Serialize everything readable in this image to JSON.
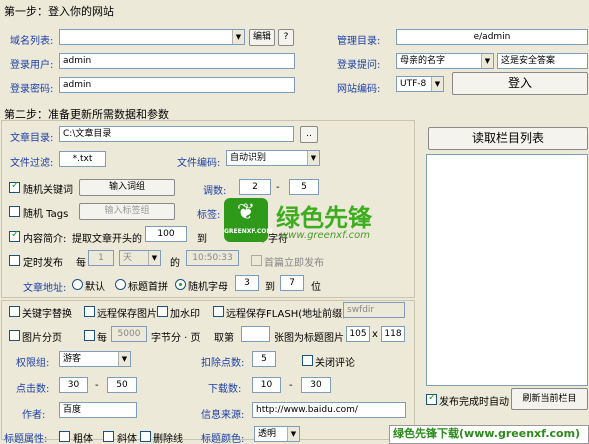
{
  "step1": {
    "title": "第一步：登入你的网站",
    "domain_label": "域名列表:",
    "domain_value": "",
    "edit_button": "编辑",
    "help_button": "?",
    "user_label": "登录用户:",
    "user_value": "admin",
    "password_label": "登录密码:",
    "password_value": "admin",
    "admin_dir_label": "管理目录:",
    "admin_dir_value": "e/admin",
    "prompt_label": "登录提问:",
    "prompt_value": "母亲的名字",
    "answer_value": "这是安全答案",
    "encoding_label": "网站编码:",
    "encoding_value": "UTF-8",
    "login_button": "登入"
  },
  "step2": {
    "title": "第二步：准备更新所需数据和参数",
    "article_dir_label": "文章目录:",
    "article_dir_value": "C:\\文章目录",
    "browse_button": "..",
    "file_filter_label": "文件过滤:",
    "file_filter_value": "*.txt",
    "file_encoding_label": "文件编码:",
    "file_encoding_value": "自动识别",
    "read_columns_button": "读取栏目列表",
    "random_keywords_label": "随机关键词",
    "input_keywords_button": "输入词组",
    "clicks_label": "调数:",
    "clicks_from": "2",
    "clicks_dash": "-",
    "clicks_to": "5",
    "random_tags_label": "随机 Tags",
    "input_tags_button": "输入标签组",
    "tags_label": "标签:",
    "summary_label": "内容简介:",
    "summary_extract_label": "提取文章开头的",
    "summary_value": "100",
    "summary_to_label": "到",
    "summary_chars_label": "个字符",
    "timed_publish_label": "定时发布",
    "timed_every_label": "每",
    "timed_every_value": "1",
    "timed_unit_value": "天",
    "timed_of_label": "的",
    "timed_time_value": "10:50:33",
    "first_publish_label": "首篇立即发布",
    "url_label": "文章地址:",
    "url_default_label": "默认",
    "url_pinyin_label": "标题首拼",
    "url_random_label": "随机字母",
    "url_random_from": "3",
    "url_random_to_label": "到",
    "url_random_to": "7",
    "url_random_unit": "位"
  },
  "options": {
    "keyword_replace_label": "关键字替换",
    "remote_images_label": "远程保存图片",
    "watermark_label": "加水印",
    "remote_flash_label": "远程保存FLASH(地址前缀)",
    "remote_flash_value": "swfdir",
    "image_pages_label": "图片分页",
    "every_label": "每",
    "every_value": "5000",
    "chars_page_label": "字节分 · 页",
    "take_label": "取第",
    "take_value": "",
    "title_image_label": "张图为标题图片",
    "img_w": "105",
    "img_x": "x",
    "img_h": "118",
    "permission_label": "权限组:",
    "permission_value": "游客",
    "deduct_label": "扣除点数:",
    "deduct_value": "5",
    "close_comments_label": "关闭评论",
    "views_label": "点击数:",
    "views_from": "30",
    "views_dash": "-",
    "views_to": "50",
    "downloads_label": "下载数:",
    "downloads_from": "10",
    "downloads_dash": "-",
    "downloads_to": "30",
    "author_label": "作者:",
    "author_value": "百度",
    "source_label": "信息来源:",
    "source_value": "http://www.baidu.com/",
    "title_attr_label": "标题属性:",
    "bold_label": "粗体",
    "italic_label": "斜体",
    "strike_label": "删除线",
    "title_color_label": "标题颜色:",
    "title_color_value": "透明",
    "auto_after_publish_label": "发布完成时自动",
    "refresh_column_button": "刷新当前栏目"
  },
  "overlays": {
    "watermark_brand": "绿色先锋",
    "watermark_url": "www.greenxf.com",
    "watermark_badge": "GREENXF.COM",
    "bottom_banner": "绿色先锋下载(www.greenxf.com)"
  },
  "colors": {
    "label_blue": "#1c3fa8",
    "check_green": "#21a121",
    "watermark_green": "#3cae1e"
  }
}
